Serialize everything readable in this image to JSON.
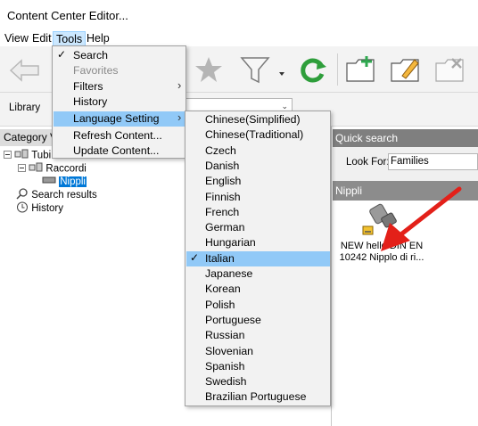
{
  "window": {
    "title": "Content Center Editor..."
  },
  "menubar": {
    "items": [
      "View",
      "Edit",
      "Tools",
      "Help"
    ]
  },
  "library": {
    "label": "Library"
  },
  "category_pane": {
    "header": "Category V",
    "tree": {
      "root": "Tubi e",
      "child": "Raccordi",
      "leaf": "Nippli",
      "search": "Search results",
      "history": "History"
    }
  },
  "quick_search": {
    "header": "Quick search",
    "look_for_label": "Look For:",
    "look_for_value": "Families"
  },
  "results": {
    "header": "Nippli",
    "family_line1": "NEW hello DIN EN",
    "family_line2": "10242 Nipplo di ri..."
  },
  "tools_menu": {
    "items": [
      {
        "label": "Search",
        "checked": true,
        "disabled": false,
        "submenu": false
      },
      {
        "label": "Favorites",
        "checked": false,
        "disabled": true,
        "submenu": false
      },
      {
        "label": "Filters",
        "checked": false,
        "disabled": false,
        "submenu": true
      },
      {
        "label": "History",
        "checked": false,
        "disabled": false,
        "submenu": false
      },
      {
        "label": "Language Setting",
        "checked": false,
        "disabled": false,
        "submenu": true,
        "highlighted": true
      },
      {
        "label": "Refresh Content...",
        "checked": false,
        "disabled": false,
        "submenu": false
      },
      {
        "label": "Update Content...",
        "checked": false,
        "disabled": false,
        "submenu": false
      }
    ]
  },
  "language_menu": {
    "selected": "Italian",
    "items": [
      "Chinese(Simplified)",
      "Chinese(Traditional)",
      "Czech",
      "Danish",
      "English",
      "Finnish",
      "French",
      "German",
      "Hungarian",
      "Italian",
      "Japanese",
      "Korean",
      "Polish",
      "Portuguese",
      "Russian",
      "Slovenian",
      "Spanish",
      "Swedish",
      "Brazilian Portuguese"
    ]
  },
  "colors": {
    "accent": "#0078d7",
    "menu_highlight": "#91c9f7",
    "arrow_red": "#e32019",
    "refresh_green": "#2e9e3b"
  },
  "icons": {
    "toolbar": [
      "back-arrow-icon",
      "star-icon",
      "filter-icon",
      "refresh-icon",
      "new-folder-icon",
      "edit-folder-icon",
      "delete-folder-icon"
    ]
  }
}
